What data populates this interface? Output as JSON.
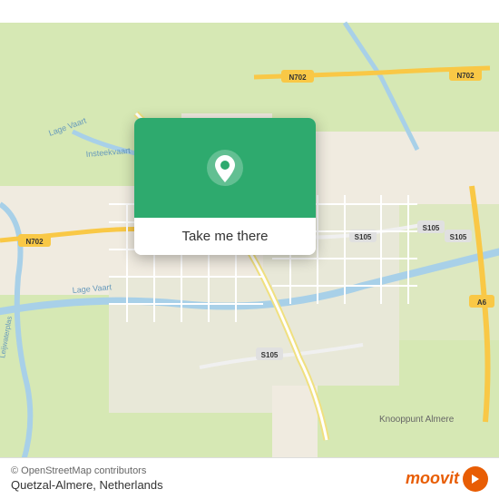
{
  "map": {
    "alt": "Map of Almere, Netherlands",
    "attribution": "© OpenStreetMap contributors",
    "accent_color": "#2eaa6e",
    "location_name": "Quetzal-Almere",
    "country": "Netherlands"
  },
  "popup": {
    "button_label": "Take me there",
    "pin_icon": "location-pin"
  },
  "bottom_bar": {
    "copyright": "© OpenStreetMap contributors",
    "location": "Quetzal-Almere, Netherlands",
    "brand": "moovit"
  }
}
